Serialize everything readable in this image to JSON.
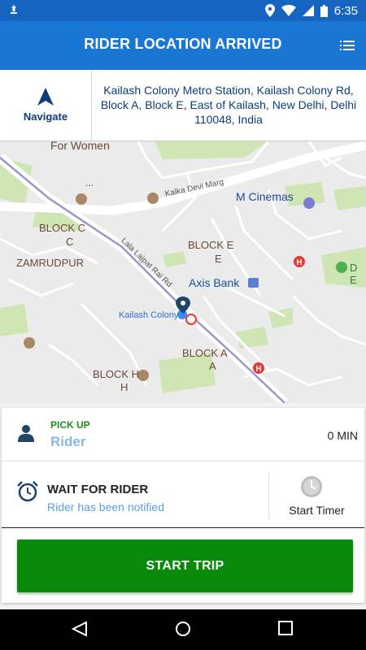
{
  "status_bar": {
    "time": "6:35",
    "icons": [
      "notification-icon",
      "location-icon",
      "wifi-icon",
      "signal-icon",
      "battery-icon"
    ]
  },
  "app_bar": {
    "title": "RIDER LOCATION ARRIVED",
    "menu_icon": "list-icon"
  },
  "navigate": {
    "label": "Navigate",
    "icon": "navigation-arrow-icon"
  },
  "address": "Kailash Colony Metro Station, Kailash Colony Rd, Block A, Block E, East of Kailash, New Delhi, Delhi 110048, India",
  "map": {
    "labels": {
      "for_women": "For Women",
      "dots": "...",
      "kalka_devi_marg": "Kalka Devi Marg",
      "m_cinemas": "M Cinemas",
      "block_c": "BLOCK C",
      "block_c_letter": "C",
      "block_e": "BLOCK E",
      "block_e_letter": "E",
      "zamrudpur": "ZAMRUDPUR",
      "lala_lajpat": "Lala Lajpat Rai Rd",
      "axis_bank": "Axis Bank",
      "kailash_colony": "Kailash Colony",
      "block_a": "BLOCK A",
      "block_a_letter": "A",
      "block_h": "BLOCK H",
      "block_h_letter": "H",
      "d_e": "D E"
    }
  },
  "pickup": {
    "label": "PICK UP",
    "rider": "Rider",
    "eta": "0 MIN"
  },
  "wait": {
    "title": "WAIT FOR RIDER",
    "subtitle": "Rider has been notified",
    "timer_label": "Start Timer"
  },
  "actions": {
    "start_trip": "START TRIP"
  },
  "colors": {
    "status_bar": "#1565c0",
    "app_bar": "#1976d2",
    "accent_green": "#0a8a0a",
    "pickup_green": "#1e8e1e",
    "link_blue": "#5aa0e0"
  }
}
